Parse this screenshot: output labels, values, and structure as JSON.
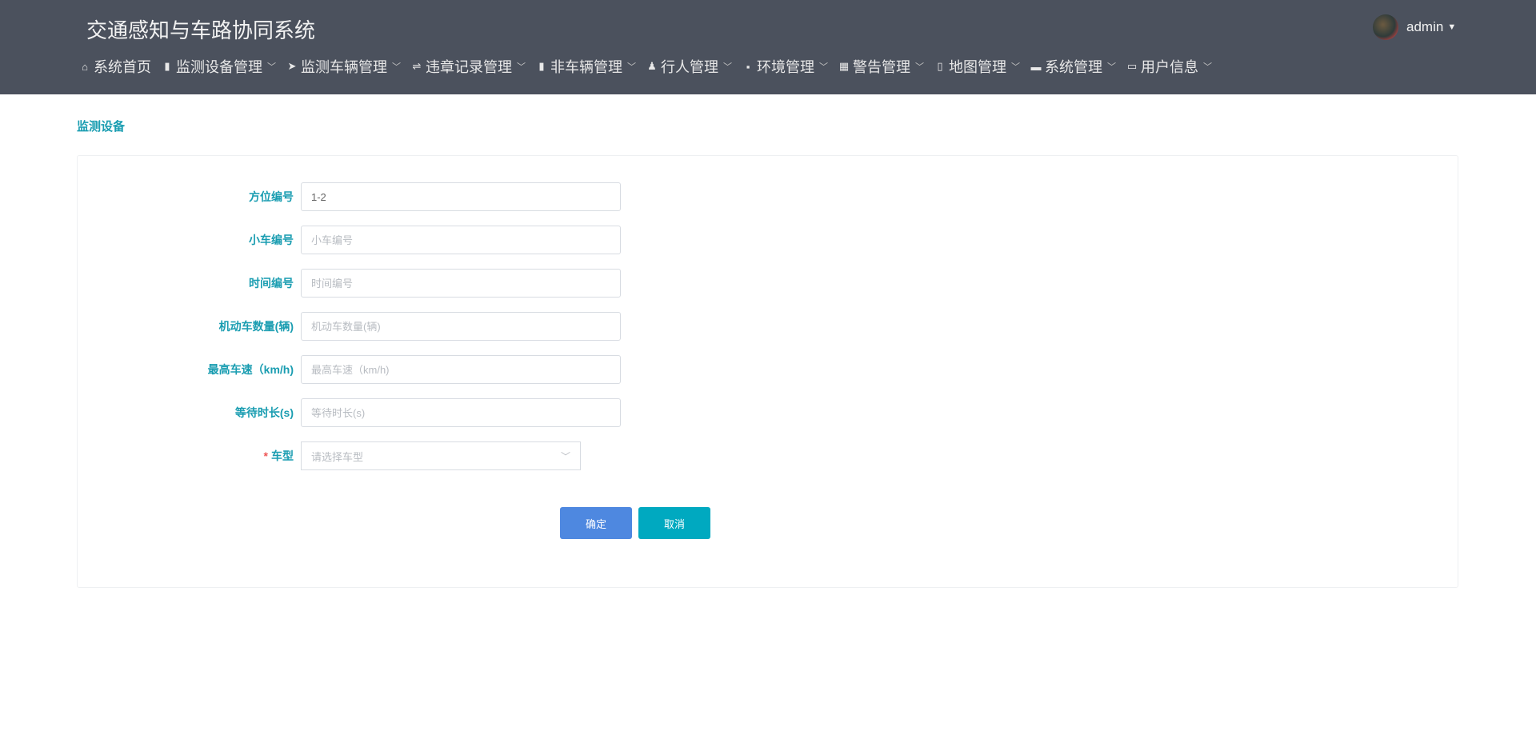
{
  "header": {
    "title": "交通感知与车路协同系统",
    "user": "admin"
  },
  "nav": [
    {
      "label": "系统首页",
      "icon": "⌂",
      "dropdown": false
    },
    {
      "label": "监测设备管理",
      "icon": "▮",
      "dropdown": true
    },
    {
      "label": "监测车辆管理",
      "icon": "➤",
      "dropdown": true
    },
    {
      "label": "违章记录管理",
      "icon": "⇌",
      "dropdown": true
    },
    {
      "label": "非车辆管理",
      "icon": "▮",
      "dropdown": true
    },
    {
      "label": "行人管理",
      "icon": "♟",
      "dropdown": true
    },
    {
      "label": "环境管理",
      "icon": "▪",
      "dropdown": true
    },
    {
      "label": "警告管理",
      "icon": "▦",
      "dropdown": true
    },
    {
      "label": "地图管理",
      "icon": "▯",
      "dropdown": true
    },
    {
      "label": "系统管理",
      "icon": "▬",
      "dropdown": true
    },
    {
      "label": "用户信息",
      "icon": "▭",
      "dropdown": true
    }
  ],
  "page_title": "监测设备",
  "form": {
    "fields": [
      {
        "label": "方位编号",
        "value": "1-2",
        "placeholder": "方位编号"
      },
      {
        "label": "小车编号",
        "value": "",
        "placeholder": "小车编号"
      },
      {
        "label": "时间编号",
        "value": "",
        "placeholder": "时间编号"
      },
      {
        "label": "机动车数量(辆)",
        "value": "",
        "placeholder": "机动车数量(辆)"
      },
      {
        "label": "最高车速（km/h)",
        "value": "",
        "placeholder": "最高车速（km/h)"
      },
      {
        "label": "等待时长(s)",
        "value": "",
        "placeholder": "等待时长(s)"
      }
    ],
    "select": {
      "label": "车型",
      "required_mark": "*",
      "placeholder": "请选择车型"
    },
    "confirm": "确定",
    "cancel": "取消"
  },
  "colors": {
    "header": "#4b515d",
    "accent": "#1a9db1",
    "confirm": "#4e88e0",
    "cancel": "#00a9c0"
  }
}
